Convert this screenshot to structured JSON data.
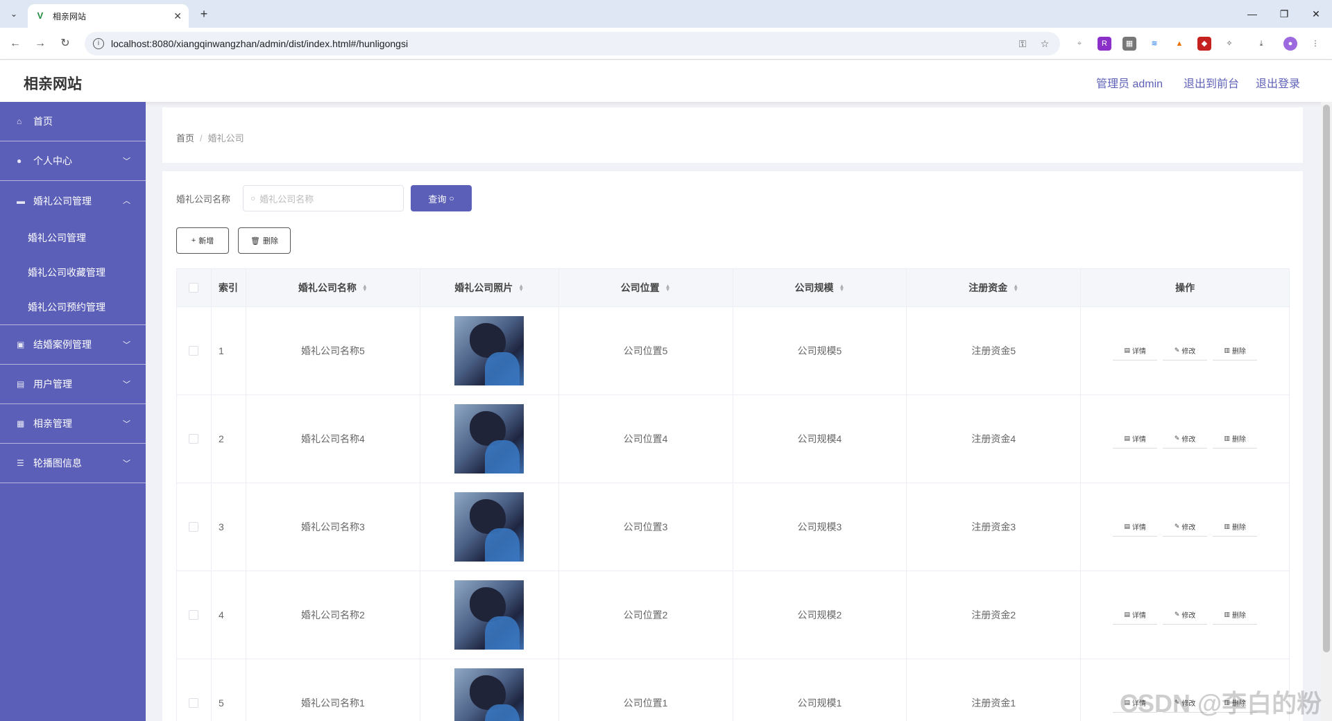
{
  "browser": {
    "tab_title": "相亲网站",
    "url": "localhost:8080/xiangqinwangzhan/admin/dist/index.html#/hunligongsi"
  },
  "header": {
    "site_title": "相亲网站",
    "admin_label": "管理员 admin",
    "front_link": "退出到前台",
    "logout_link": "退出登录"
  },
  "sidebar": {
    "items": [
      {
        "label": "首页",
        "icon": "home-icon"
      },
      {
        "label": "个人中心",
        "icon": "user-icon"
      },
      {
        "label": "婚礼公司管理",
        "icon": "briefcase-icon",
        "expanded": true,
        "children": [
          {
            "label": "婚礼公司管理"
          },
          {
            "label": "婚礼公司收藏管理"
          },
          {
            "label": "婚礼公司预约管理"
          }
        ]
      },
      {
        "label": "结婚案例管理",
        "icon": "case-icon"
      },
      {
        "label": "用户管理",
        "icon": "users-icon"
      },
      {
        "label": "相亲管理",
        "icon": "heart-icon"
      },
      {
        "label": "轮播图信息",
        "icon": "menu-icon"
      }
    ]
  },
  "breadcrumb": {
    "home": "首页",
    "current": "婚礼公司"
  },
  "search": {
    "label": "婚礼公司名称",
    "placeholder": "婚礼公司名称",
    "query_button": "查询"
  },
  "actions": {
    "add_button": "新增",
    "delete_button": "删除"
  },
  "table": {
    "columns": [
      "索引",
      "婚礼公司名称",
      "婚礼公司照片",
      "公司位置",
      "公司规模",
      "注册资金",
      "操作"
    ],
    "rows": [
      {
        "index": "1",
        "name": "婚礼公司名称5",
        "location": "公司位置5",
        "scale": "公司规模5",
        "capital": "注册资金5"
      },
      {
        "index": "2",
        "name": "婚礼公司名称4",
        "location": "公司位置4",
        "scale": "公司规模4",
        "capital": "注册资金4"
      },
      {
        "index": "3",
        "name": "婚礼公司名称3",
        "location": "公司位置3",
        "scale": "公司规模3",
        "capital": "注册资金3"
      },
      {
        "index": "4",
        "name": "婚礼公司名称2",
        "location": "公司位置2",
        "scale": "公司规模2",
        "capital": "注册资金2"
      },
      {
        "index": "5",
        "name": "婚礼公司名称1",
        "location": "公司位置1",
        "scale": "公司规模1",
        "capital": "注册资金1"
      }
    ],
    "row_actions": {
      "detail": "详情",
      "edit": "修改",
      "delete": "删除"
    }
  },
  "watermark": "CSDN @李白的粉",
  "colors": {
    "accent": "#5b5fb8",
    "background": "#f1f2f7"
  }
}
